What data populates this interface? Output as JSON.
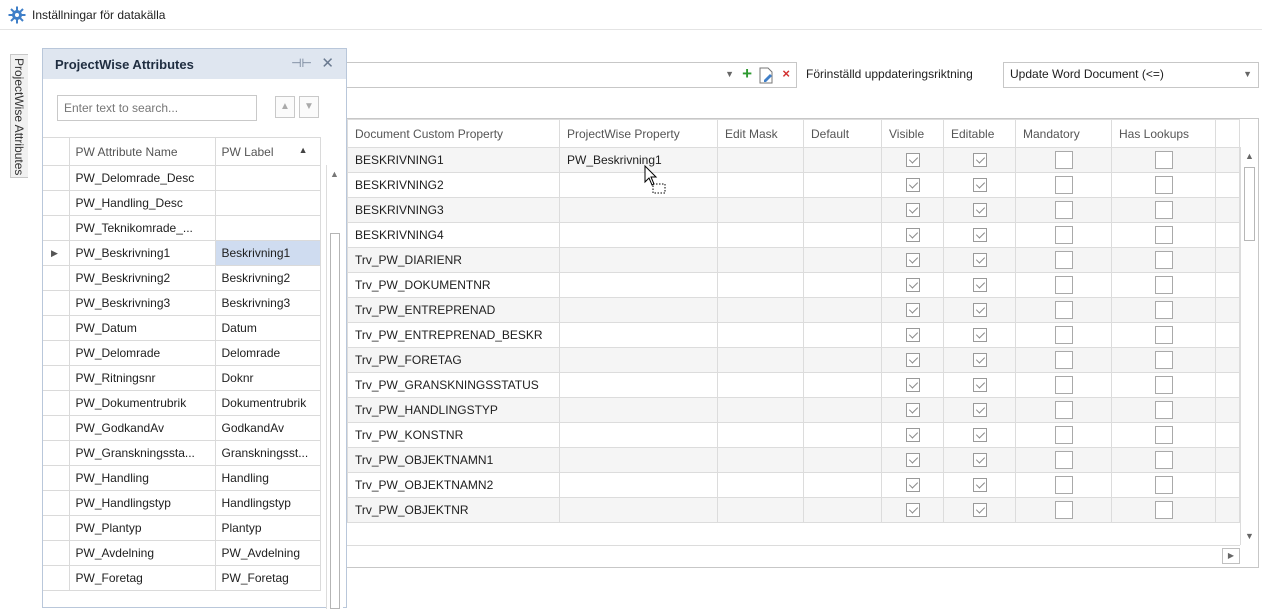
{
  "window": {
    "title": "Inställningar för datakälla"
  },
  "side_tab": {
    "label": "ProjectWise Attributes"
  },
  "panel": {
    "title": "ProjectWise Attributes",
    "search_placeholder": "Enter text to search...",
    "headers": [
      "PW Attribute Name",
      "PW Label"
    ],
    "rows": [
      {
        "name": "PW_Delomrade_Desc",
        "label": ""
      },
      {
        "name": "PW_Handling_Desc",
        "label": ""
      },
      {
        "name": "PW_Teknikomrade_...",
        "label": ""
      },
      {
        "name": "PW_Beskrivning1",
        "label": "Beskrivning1",
        "selected": true
      },
      {
        "name": "PW_Beskrivning2",
        "label": "Beskrivning2"
      },
      {
        "name": "PW_Beskrivning3",
        "label": "Beskrivning3"
      },
      {
        "name": "PW_Datum",
        "label": "Datum"
      },
      {
        "name": "PW_Delomrade",
        "label": "Delomrade"
      },
      {
        "name": "PW_Ritningsnr",
        "label": "Doknr"
      },
      {
        "name": "PW_Dokumentrubrik",
        "label": "Dokumentrubrik"
      },
      {
        "name": "PW_GodkandAv",
        "label": "GodkandAv"
      },
      {
        "name": "PW_Granskningssta...",
        "label": "Granskningsst..."
      },
      {
        "name": "PW_Handling",
        "label": "Handling"
      },
      {
        "name": "PW_Handlingstyp",
        "label": "Handlingstyp"
      },
      {
        "name": "PW_Plantyp",
        "label": "Plantyp"
      },
      {
        "name": "PW_Avdelning",
        "label": "PW_Avdelning"
      },
      {
        "name": "PW_Foretag",
        "label": "PW_Foretag"
      }
    ]
  },
  "direction": {
    "label": "Förinställd uppdateringsriktning",
    "value": "Update Word Document  (<=)"
  },
  "main_grid": {
    "headers": [
      "Document Custom Property",
      "ProjectWise Property",
      "Edit Mask",
      "Default",
      "Visible",
      "Editable",
      "Mandatory",
      "Has Lookups"
    ],
    "rows": [
      {
        "property": "BESKRIVNING1",
        "pw_property": "PW_Beskrivning1",
        "visible": true,
        "editable": true,
        "mandatory": false,
        "has_lookups": false
      },
      {
        "property": "BESKRIVNING2",
        "pw_property": "",
        "visible": true,
        "editable": true,
        "mandatory": false,
        "has_lookups": false
      },
      {
        "property": "BESKRIVNING3",
        "pw_property": "",
        "visible": true,
        "editable": true,
        "mandatory": false,
        "has_lookups": false
      },
      {
        "property": "BESKRIVNING4",
        "pw_property": "",
        "visible": true,
        "editable": true,
        "mandatory": false,
        "has_lookups": false
      },
      {
        "property": "Trv_PW_DIARIENR",
        "pw_property": "",
        "visible": true,
        "editable": true,
        "mandatory": false,
        "has_lookups": false
      },
      {
        "property": "Trv_PW_DOKUMENTNR",
        "pw_property": "",
        "visible": true,
        "editable": true,
        "mandatory": false,
        "has_lookups": false
      },
      {
        "property": "Trv_PW_ENTREPRENAD",
        "pw_property": "",
        "visible": true,
        "editable": true,
        "mandatory": false,
        "has_lookups": false
      },
      {
        "property": "Trv_PW_ENTREPRENAD_BESKR",
        "pw_property": "",
        "visible": true,
        "editable": true,
        "mandatory": false,
        "has_lookups": false
      },
      {
        "property": "Trv_PW_FORETAG",
        "pw_property": "",
        "visible": true,
        "editable": true,
        "mandatory": false,
        "has_lookups": false
      },
      {
        "property": "Trv_PW_GRANSKNINGSSTATUS",
        "pw_property": "",
        "visible": true,
        "editable": true,
        "mandatory": false,
        "has_lookups": false
      },
      {
        "property": "Trv_PW_HANDLINGSTYP",
        "pw_property": "",
        "visible": true,
        "editable": true,
        "mandatory": false,
        "has_lookups": false
      },
      {
        "property": "Trv_PW_KONSTNR",
        "pw_property": "",
        "visible": true,
        "editable": true,
        "mandatory": false,
        "has_lookups": false
      },
      {
        "property": "Trv_PW_OBJEKTNAMN1",
        "pw_property": "",
        "visible": true,
        "editable": true,
        "mandatory": false,
        "has_lookups": false
      },
      {
        "property": "Trv_PW_OBJEKTNAMN2",
        "pw_property": "",
        "visible": true,
        "editable": true,
        "mandatory": false,
        "has_lookups": false
      },
      {
        "property": "Trv_PW_OBJEKTNR",
        "pw_property": "",
        "visible": true,
        "editable": true,
        "mandatory": false,
        "has_lookups": false
      }
    ]
  },
  "colors": {
    "panel_header_bg": "#dfe6f0",
    "selected_row_bg": "#cfdcf0",
    "gear_icon": "#3f7fc8",
    "add_icon": "#2e9a30",
    "delete_icon": "#d23030"
  }
}
